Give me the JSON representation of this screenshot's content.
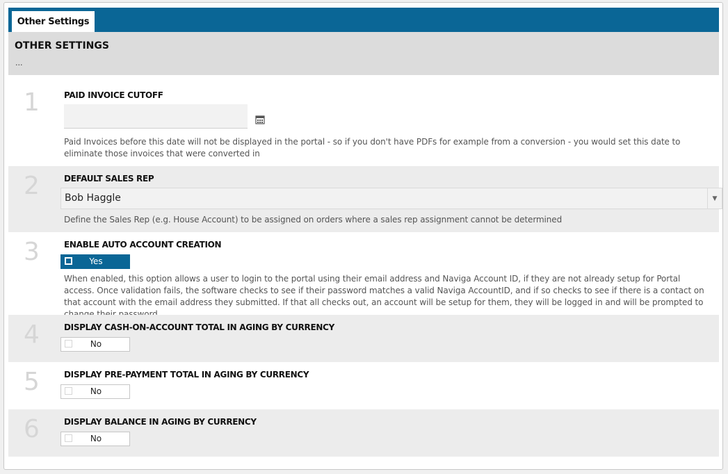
{
  "tab": {
    "label": "Other Settings"
  },
  "header": {
    "title": "OTHER SETTINGS",
    "subtitle": "..."
  },
  "settings": [
    {
      "number": "1",
      "label": "PAID INVOICE CUTOFF",
      "value": "",
      "description": "Paid Invoices before this date will not be displayed in the portal - so if you don't have PDFs for example from a conversion - you would set this date to eliminate those invoices that were converted in"
    },
    {
      "number": "2",
      "label": "DEFAULT SALES REP",
      "value": "Bob Haggle",
      "description": "Define the Sales Rep (e.g. House Account) to be assigned on orders where a sales rep assignment cannot be determined"
    },
    {
      "number": "3",
      "label": "ENABLE AUTO ACCOUNT CREATION",
      "value": "Yes",
      "description": "When enabled, this option allows a user to login to the portal using their email address and Naviga Account ID, if they are not already setup for Portal access. Once validation fails, the software checks to see if their password matches a valid Naviga AccountID, and if so checks to see if there is a contact on that account with the email address they submitted. If that all checks out, an account will be setup for them, they will be logged in and will be prompted to change their password."
    },
    {
      "number": "4",
      "label": "DISPLAY CASH-ON-ACCOUNT TOTAL IN AGING BY CURRENCY",
      "value": "No"
    },
    {
      "number": "5",
      "label": "DISPLAY PRE-PAYMENT TOTAL IN AGING BY CURRENCY",
      "value": "No"
    },
    {
      "number": "6",
      "label": "DISPLAY BALANCE IN AGING BY CURRENCY",
      "value": "No"
    }
  ],
  "colors": {
    "accent": "#0a6696",
    "header_bg": "#dcdcdc",
    "alt_row_bg": "#ececec"
  },
  "icons": {
    "date_picker": "calendar-icon",
    "dropdown": "chevron-down-icon"
  }
}
